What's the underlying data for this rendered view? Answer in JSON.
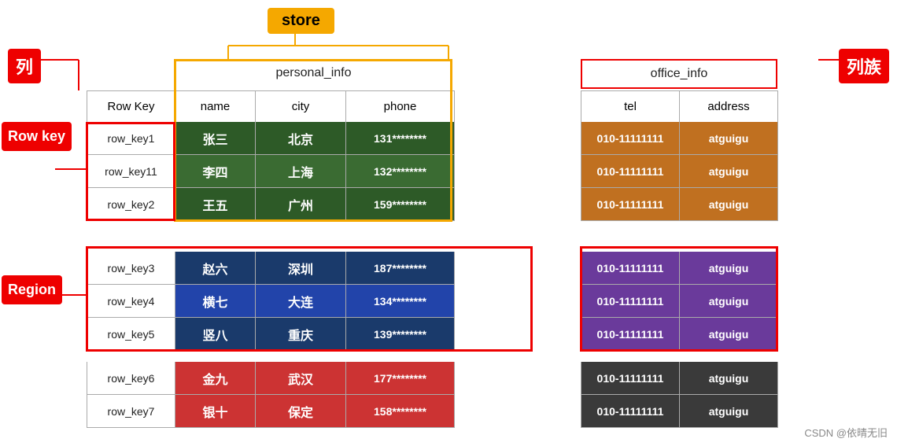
{
  "labels": {
    "lie": "列",
    "liezu": "列族",
    "rowkey": "Row key",
    "region": "Region"
  },
  "store": {
    "label": "store"
  },
  "headers": {
    "personal_info": "personal_info",
    "office_info": "office_info",
    "row_key": "Row Key",
    "name": "name",
    "city": "city",
    "phone": "phone",
    "tel": "tel",
    "address": "address"
  },
  "rows": [
    {
      "key": "row_key1",
      "name": "张三",
      "city": "北京",
      "phone": "131********",
      "tel": "010-11111111",
      "address": "atguigu",
      "group": "top"
    },
    {
      "key": "row_key11",
      "name": "李四",
      "city": "上海",
      "phone": "132********",
      "tel": "010-11111111",
      "address": "atguigu",
      "group": "top"
    },
    {
      "key": "row_key2",
      "name": "王五",
      "city": "广州",
      "phone": "159********",
      "tel": "010-11111111",
      "address": "atguigu",
      "group": "top"
    },
    {
      "key": "row_key3",
      "name": "赵六",
      "city": "深圳",
      "phone": "187********",
      "tel": "010-11111111",
      "address": "atguigu",
      "group": "region"
    },
    {
      "key": "row_key4",
      "name": "横七",
      "city": "大连",
      "phone": "134********",
      "tel": "010-11111111",
      "address": "atguigu",
      "group": "region"
    },
    {
      "key": "row_key5",
      "name": "竖八",
      "city": "重庆",
      "phone": "139********",
      "tel": "010-11111111",
      "address": "atguigu",
      "group": "region"
    },
    {
      "key": "row_key6",
      "name": "金九",
      "city": "武汉",
      "phone": "177********",
      "tel": "010-11111111",
      "address": "atguigu",
      "group": "bottom"
    },
    {
      "key": "row_key7",
      "name": "银十",
      "city": "保定",
      "phone": "158********",
      "tel": "010-11111111",
      "address": "atguigu",
      "group": "bottom"
    }
  ],
  "watermark": "CSDN @依晴无旧"
}
